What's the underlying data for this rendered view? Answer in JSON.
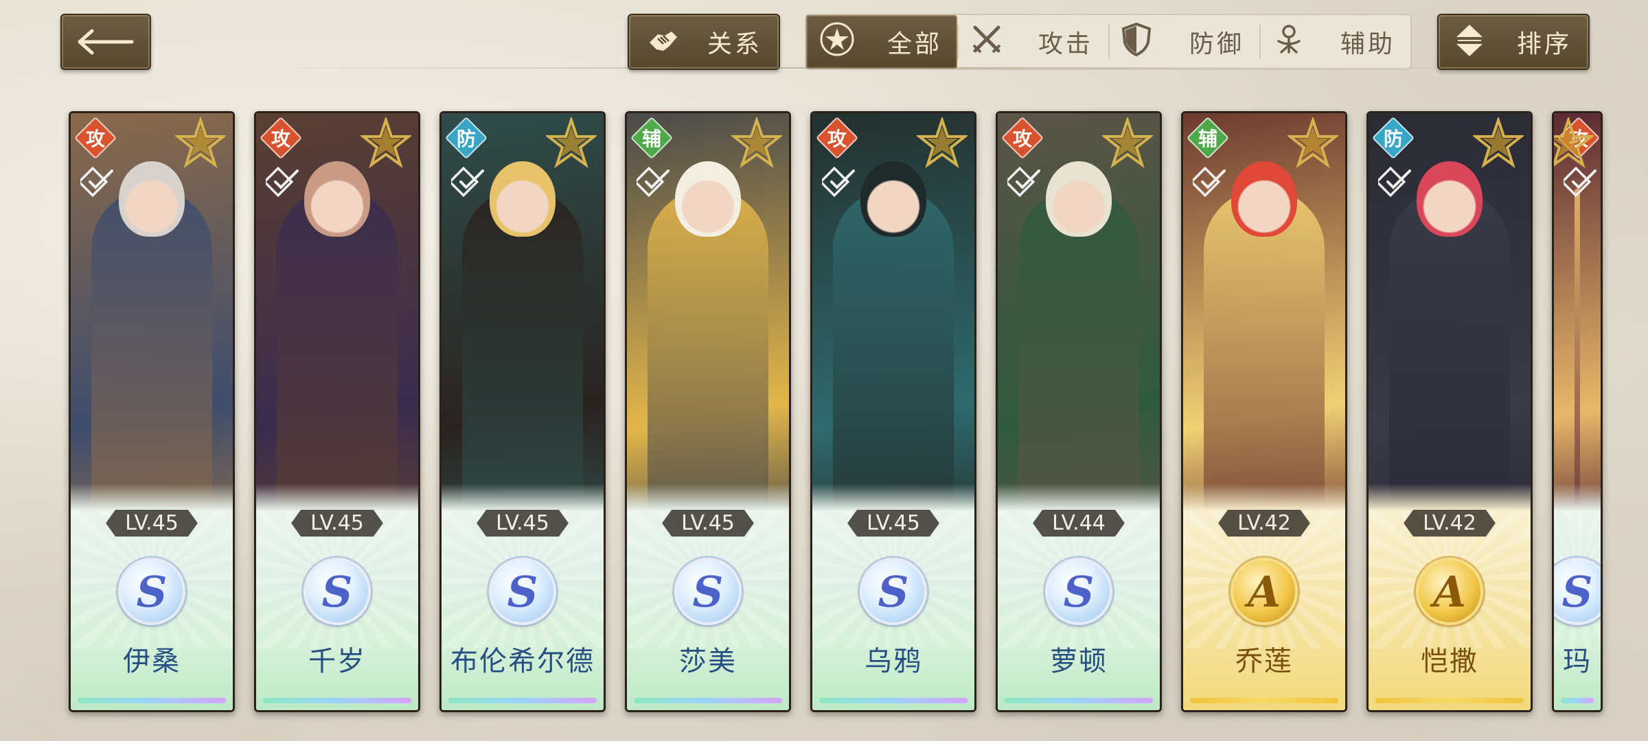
{
  "toolbar": {
    "relation_label": "关系",
    "sort_label": "排序",
    "filters": [
      {
        "label": "全部",
        "icon": "star-circle-icon",
        "active": true
      },
      {
        "label": "攻击",
        "icon": "crossed-swords-icon",
        "active": false
      },
      {
        "label": "防御",
        "icon": "shield-icon",
        "active": false
      },
      {
        "label": "辅助",
        "icon": "support-icon",
        "active": false
      }
    ]
  },
  "colors": {
    "attack": "#d9532f",
    "defense": "#3aa6c6",
    "support": "#4fa84a",
    "toolbar_dark": "#5f4d36"
  },
  "characters": [
    {
      "name": "伊桑",
      "type": "攻",
      "level": "LV.45",
      "rank": "S",
      "palette": [
        "#8a6a4a",
        "#d7d3cc",
        "#3f4d6e"
      ]
    },
    {
      "name": "千岁",
      "type": "攻",
      "level": "LV.45",
      "rank": "S",
      "palette": [
        "#5a3f32",
        "#c99b84",
        "#3a2c4e"
      ]
    },
    {
      "name": "布伦希尔德",
      "type": "防",
      "level": "LV.45",
      "rank": "S",
      "palette": [
        "#2f4d4a",
        "#e8c26a",
        "#2a2320"
      ]
    },
    {
      "name": "莎美",
      "type": "辅",
      "level": "LV.45",
      "rank": "S",
      "palette": [
        "#4a4a4a",
        "#f2eee2",
        "#e3b64a"
      ]
    },
    {
      "name": "乌鸦",
      "type": "攻",
      "level": "LV.45",
      "rank": "S",
      "palette": [
        "#24302e",
        "#1f2a2a",
        "#2f6a6e"
      ]
    },
    {
      "name": "萝顿",
      "type": "攻",
      "level": "LV.44",
      "rank": "S",
      "palette": [
        "#5b5446",
        "#e8e2d0",
        "#2f5a3e"
      ]
    },
    {
      "name": "乔莲",
      "type": "辅",
      "level": "LV.42",
      "rank": "A",
      "palette": [
        "#6e3a30",
        "#e04838",
        "#f2d074"
      ]
    },
    {
      "name": "恺撒",
      "type": "防",
      "level": "LV.42",
      "rank": "A",
      "palette": [
        "#2b2b34",
        "#d9485a",
        "#3a3a48"
      ]
    },
    {
      "name": "玛",
      "type": "攻",
      "level": "",
      "rank": "S",
      "palette": [
        "#5a2a34",
        "#f2c7d2",
        "#e8b86a"
      ]
    }
  ]
}
